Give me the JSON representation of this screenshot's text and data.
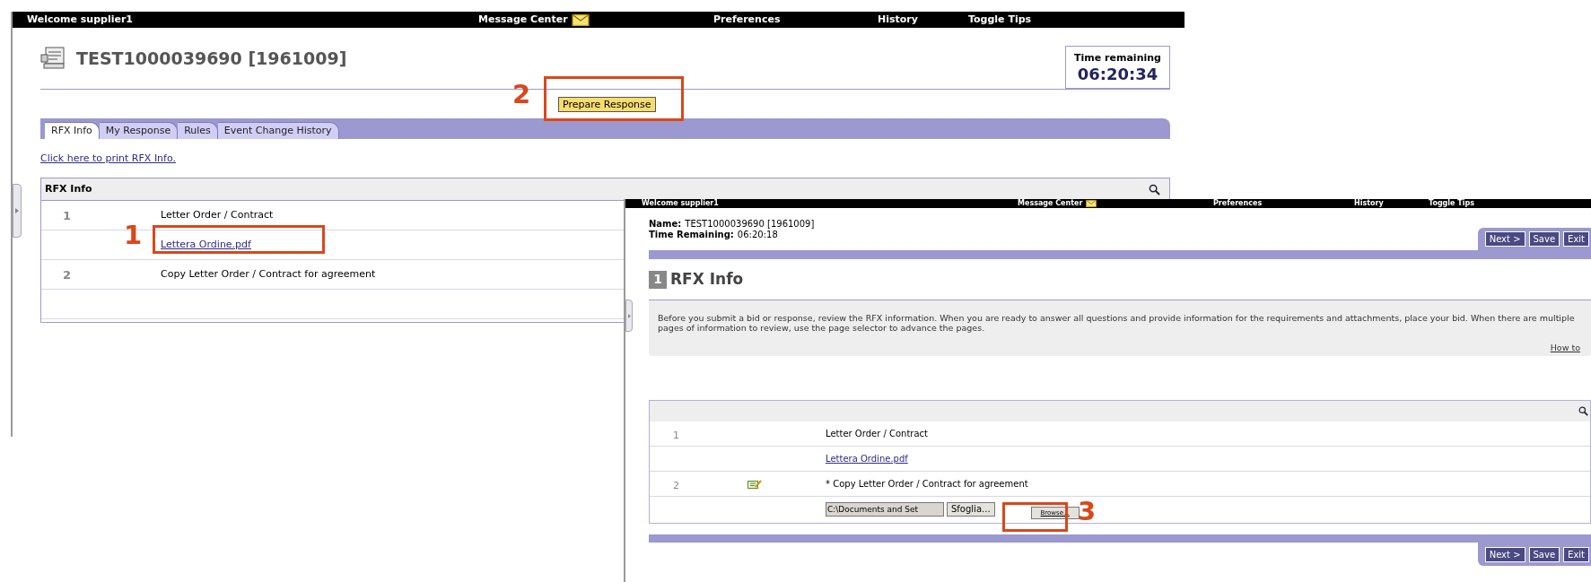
{
  "back_window": {
    "top_bar": {
      "welcome": "Welcome supplier1",
      "menu": [
        {
          "label": "Message Center",
          "kind": "mail"
        },
        {
          "label": "Preferences",
          "kind": "plain"
        },
        {
          "label": "History",
          "kind": "plain"
        },
        {
          "label": "Toggle Tips",
          "kind": "plain"
        }
      ]
    },
    "title": "TEST1000039690 [1961009]",
    "time_remaining": {
      "label": "Time remaining",
      "value": "06:20:34"
    },
    "prepare_button": "Prepare Response",
    "tabs": [
      {
        "label": "RFX Info",
        "selected": true
      },
      {
        "label": "My Response",
        "selected": false
      },
      {
        "label": "Rules",
        "selected": false
      },
      {
        "label": "Event Change History",
        "selected": false
      }
    ],
    "print_link": "Click here to print RFX Info.",
    "table": {
      "title": "RFX Info",
      "rows": [
        {
          "kind": "text",
          "number": "1",
          "text": "Letter Order / Contract"
        },
        {
          "kind": "link",
          "text": "Lettera Ordine.pdf"
        },
        {
          "kind": "text",
          "number": "2",
          "text": "Copy Letter Order / Contract for agreement"
        },
        {
          "kind": "empty"
        }
      ]
    }
  },
  "front_window": {
    "top_bar": {
      "welcome": "Welcome supplier1",
      "menu": [
        {
          "label": "Message Center",
          "kind": "mail"
        },
        {
          "label": "Preferences",
          "kind": "plain"
        },
        {
          "label": "History",
          "kind": "plain"
        },
        {
          "label": "Toggle Tips",
          "kind": "plain"
        }
      ]
    },
    "name_label": "Name:",
    "name": "TEST1000039690 [1961009]",
    "time_label": "Time Remaining:",
    "time": "06:20:18",
    "nav_buttons": [
      "Next >",
      "Save",
      "Exit"
    ],
    "section_number": "1",
    "section_title": "RFX Info",
    "description": "Before you submit a bid or response, review the RFX information. When you are ready to answer all questions and provide information for the requirements and attachments, place your bid. When there are multiple pages of information to review, use the page selector to advance the pages.",
    "how_to": "How to",
    "table": {
      "rows": [
        {
          "kind": "text",
          "number": "1",
          "text": "Letter Order / Contract"
        },
        {
          "kind": "link",
          "text": "Lettera Ordine.pdf"
        },
        {
          "kind": "edit",
          "number": "2",
          "text": "* Copy Letter Order / Contract for agreement"
        },
        {
          "kind": "file",
          "value": "C:\\Documents and Set",
          "button": "Sfoglia...",
          "extra_button": "Browse..."
        }
      ]
    },
    "bottom_nav_buttons": [
      "Next >",
      "Save",
      "Exit"
    ]
  },
  "callouts": [
    {
      "label": "1"
    },
    {
      "label": "2"
    },
    {
      "label": "3"
    }
  ]
}
